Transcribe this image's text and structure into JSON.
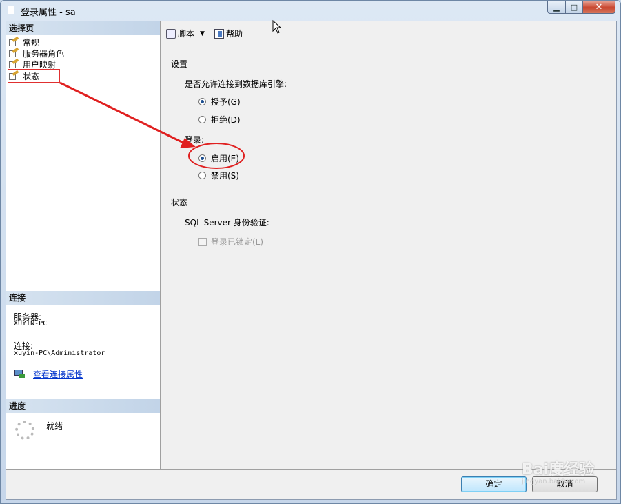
{
  "window": {
    "title": "登录属性 - sa"
  },
  "left": {
    "select_page_header": "选择页",
    "nav_items": [
      {
        "label": "常规"
      },
      {
        "label": "服务器角色"
      },
      {
        "label": "用户映射"
      },
      {
        "label": "状态"
      }
    ],
    "connection_header": "连接",
    "server_label": "服务器:",
    "server_value": "XUYIN-PC",
    "connection_label": "连接:",
    "connection_value": "xuyin-PC\\Administrator",
    "view_link": "查看连接属性",
    "progress_header": "进度",
    "progress_status": "就绪"
  },
  "toolbar": {
    "script_label": "脚本",
    "help_label": "帮助"
  },
  "settings": {
    "section_title": "设置",
    "permission_question": "是否允许连接到数据库引擎:",
    "grant_label": "授予(G)",
    "deny_label": "拒绝(D)",
    "login_label": "登录:",
    "enable_label": "启用(E)",
    "disable_label": "禁用(S)",
    "grant_selected": true,
    "enable_selected": true
  },
  "status": {
    "section_title": "状态",
    "auth_label": "SQL Server 身份验证:",
    "locked_label": "登录已锁定(L)"
  },
  "buttons": {
    "ok_label": "确定",
    "cancel_label": "取消"
  },
  "watermark": {
    "main": "Bai度经验",
    "sub": "jingyan.baidu.com"
  },
  "colors": {
    "annotation": "#e02020"
  }
}
